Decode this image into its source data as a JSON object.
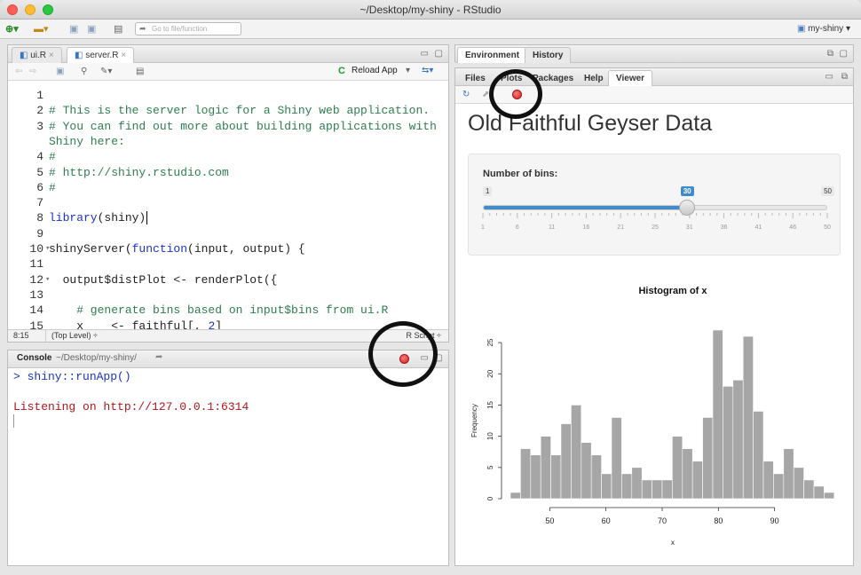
{
  "window": {
    "title": "~/Desktop/my-shiny - RStudio"
  },
  "toolbar": {
    "goto_placeholder": "Go to file/function",
    "project": "my-shiny"
  },
  "editor": {
    "tabs": [
      {
        "label": "ui.R"
      },
      {
        "label": "server.R"
      }
    ],
    "reload_label": "Reload App",
    "lines": [
      {
        "n": "1",
        "text": ""
      },
      {
        "n": "2",
        "text": "# This is the server logic for a Shiny web application."
      },
      {
        "n": "3",
        "text": "# You can find out more about building applications with"
      },
      {
        "n": "",
        "text": "Shiny here:"
      },
      {
        "n": "4",
        "text": "#"
      },
      {
        "n": "5",
        "text": "# http://shiny.rstudio.com"
      },
      {
        "n": "6",
        "text": "#"
      },
      {
        "n": "7",
        "text": ""
      },
      {
        "n": "8",
        "text": "library(shiny)"
      },
      {
        "n": "9",
        "text": ""
      },
      {
        "n": "10",
        "text": "shinyServer(function(input, output) {"
      },
      {
        "n": "11",
        "text": ""
      },
      {
        "n": "12",
        "text": "  output$distPlot <- renderPlot({"
      },
      {
        "n": "13",
        "text": ""
      },
      {
        "n": "14",
        "text": "    # generate bins based on input$bins from ui.R"
      },
      {
        "n": "15",
        "text": "    x    <- faithful[, 2]"
      }
    ],
    "status_pos": "8:15",
    "status_scope": "(Top Level) ÷",
    "status_type": "R Script ÷"
  },
  "console": {
    "title": "Console",
    "path": "~/Desktop/my-shiny/",
    "cmd": "> shiny::runApp()",
    "listening": "Listening on http://127.0.0.1:6314"
  },
  "env_panel": {
    "tabs": [
      {
        "label": "Environment"
      },
      {
        "label": "History"
      }
    ]
  },
  "viewer_panel": {
    "tabs": [
      {
        "label": "Files"
      },
      {
        "label": "Plots"
      },
      {
        "label": "Packages"
      },
      {
        "label": "Help"
      },
      {
        "label": "Viewer"
      }
    ]
  },
  "app": {
    "title": "Old Faithful Geyser Data",
    "slider_label": "Number of bins:",
    "slider_min": "1",
    "slider_max": "50",
    "slider_value": "30",
    "slider_fraction": 0.592,
    "slider_ticks": [
      "1",
      "6",
      "11",
      "16",
      "21",
      "25",
      "31",
      "36",
      "41",
      "46",
      "50"
    ]
  },
  "chart_data": {
    "type": "bar",
    "title": "Histogram of x",
    "xlabel": "x",
    "ylabel": "Frequency",
    "x_start": 43.0,
    "bin_width": 1.8,
    "values": [
      1,
      8,
      7,
      10,
      7,
      12,
      15,
      9,
      7,
      4,
      13,
      4,
      5,
      3,
      3,
      3,
      10,
      8,
      6,
      13,
      27,
      18,
      19,
      26,
      14,
      6,
      4,
      8,
      5,
      3,
      2,
      1
    ],
    "xlim": [
      43,
      97
    ],
    "ylim": [
      0,
      27
    ],
    "xticks": [
      "50",
      "60",
      "70",
      "80",
      "90"
    ],
    "yticks": [
      "0",
      "5",
      "10",
      "15",
      "20",
      "25"
    ],
    "bar_color": "#a6a6a6"
  }
}
